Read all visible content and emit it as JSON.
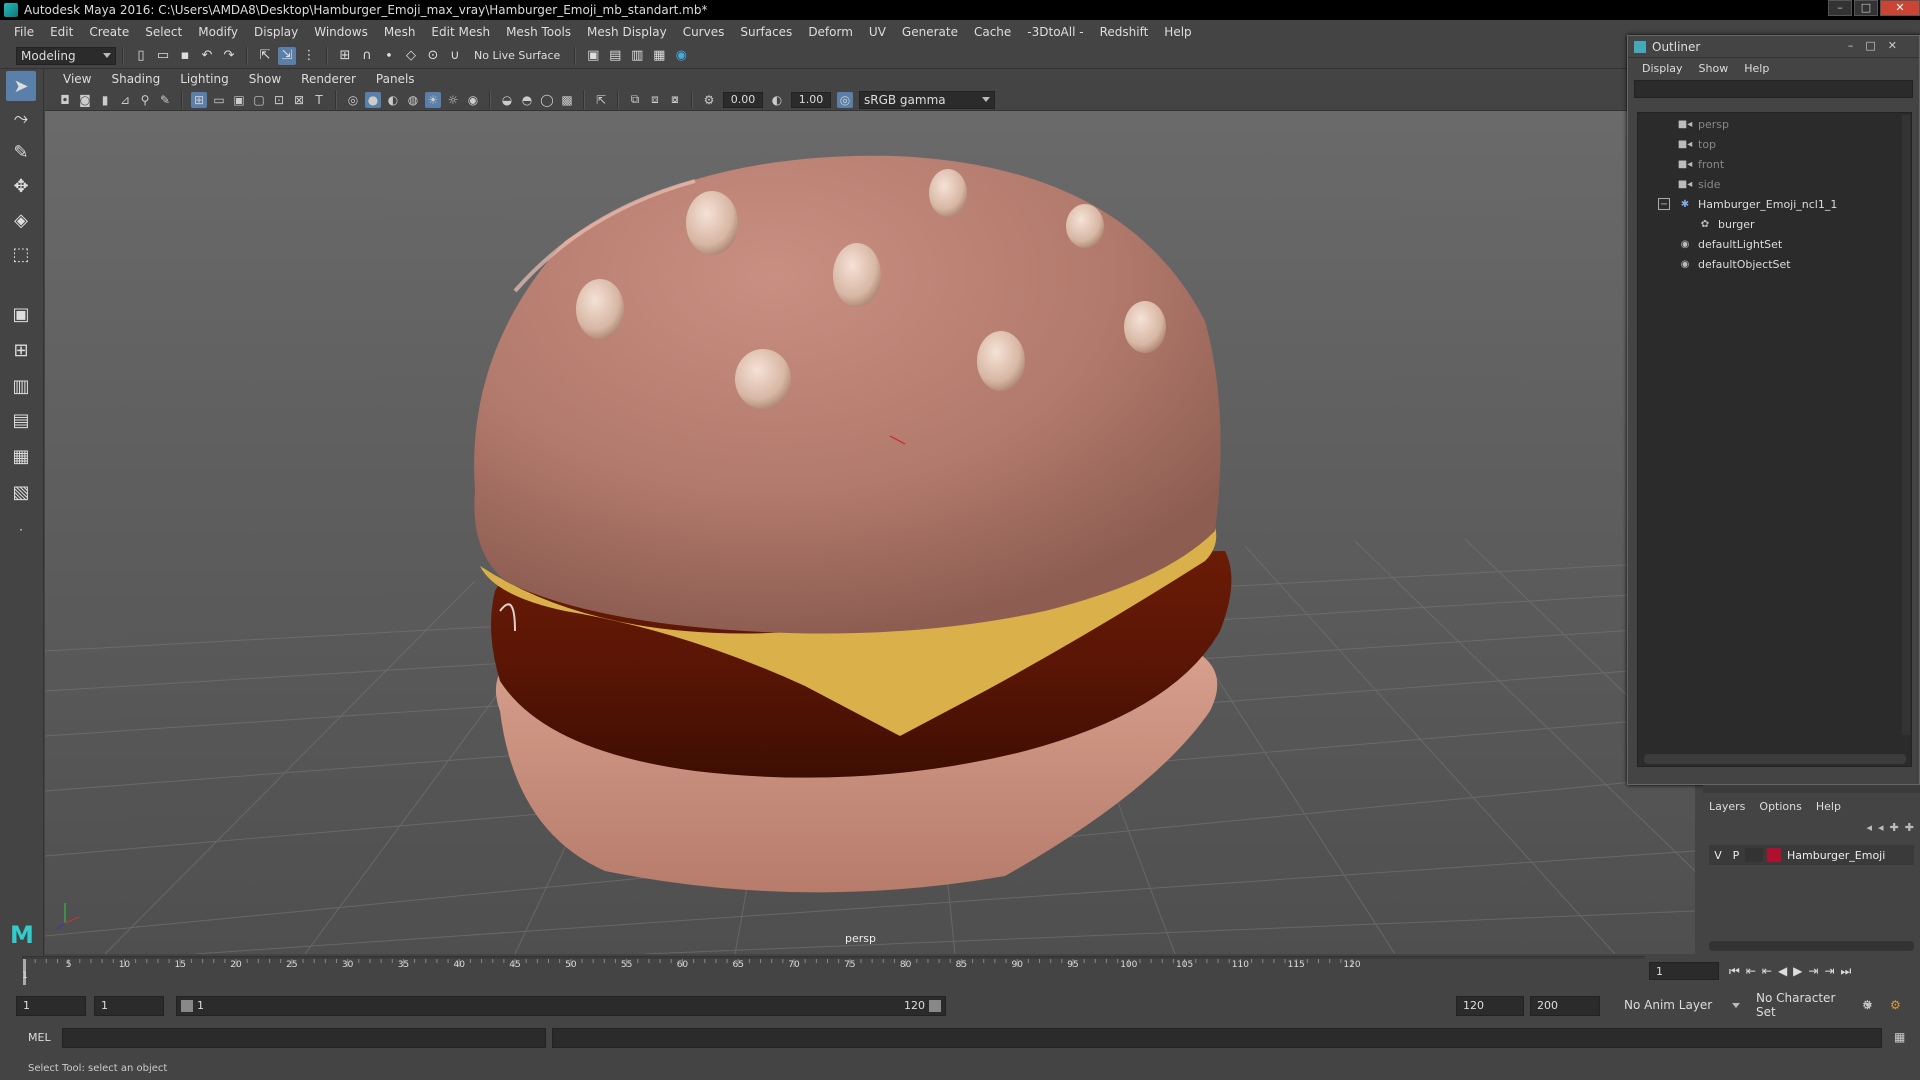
{
  "window": {
    "title": "Autodesk Maya 2016: C:\\Users\\AMDA8\\Desktop\\Hamburger_Emoji_max_vray\\Hamburger_Emoji_mb_standart.mb*",
    "minimize": "–",
    "maximize": "□",
    "close": "✕"
  },
  "menubar": [
    "File",
    "Edit",
    "Create",
    "Select",
    "Modify",
    "Display",
    "Windows",
    "Mesh",
    "Edit Mesh",
    "Mesh Tools",
    "Mesh Display",
    "Curves",
    "Surfaces",
    "Deform",
    "UV",
    "Generate",
    "Cache",
    "-3DtoAll -",
    "Redshift",
    "Help"
  ],
  "shelf": {
    "mode": "Modeling",
    "live_surface": "No Live Surface"
  },
  "panel_menu": [
    "View",
    "Shading",
    "Lighting",
    "Show",
    "Renderer",
    "Panels"
  ],
  "panel_toolbar": {
    "exposure": "0.00",
    "gamma": "1.00",
    "color_space": "sRGB gamma"
  },
  "viewport": {
    "camera_label": "persp"
  },
  "outliner": {
    "title": "Outliner",
    "menu": [
      "Display",
      "Show",
      "Help"
    ],
    "nodes": [
      {
        "label": "persp",
        "icon": "camera-icon"
      },
      {
        "label": "top",
        "icon": "camera-icon"
      },
      {
        "label": "front",
        "icon": "camera-icon"
      },
      {
        "label": "side",
        "icon": "camera-icon"
      },
      {
        "label": "Hamburger_Emoji_ncl1_1",
        "icon": "asterisk-icon"
      },
      {
        "label": "burger",
        "icon": "mesh-icon"
      },
      {
        "label": "defaultLightSet",
        "icon": "set-icon"
      },
      {
        "label": "defaultObjectSet",
        "icon": "set-icon"
      }
    ],
    "expand_symbol": "−"
  },
  "layers": {
    "menu": [
      "Layers",
      "Options",
      "Help"
    ],
    "row": {
      "v": "V",
      "p": "P",
      "name": "Hamburger_Emoji",
      "color": "#b01030"
    }
  },
  "timeline": {
    "ticks": [
      "5",
      "10",
      "15",
      "20",
      "25",
      "30",
      "35",
      "40",
      "45",
      "50",
      "55",
      "60",
      "65",
      "70",
      "75",
      "80",
      "85",
      "90",
      "95",
      "100",
      "105",
      "110",
      "115",
      "120"
    ],
    "start_tick": "1",
    "current_frame": "1"
  },
  "range": {
    "start": "1",
    "playback_start": "1",
    "slider_start": "1",
    "slider_end": "120",
    "playback_end": "120",
    "end": "200",
    "anim_layer": "No Anim Layer",
    "character_set": "No Character Set"
  },
  "command": {
    "language": "MEL"
  },
  "status": {
    "text": "Select Tool: select an object"
  }
}
